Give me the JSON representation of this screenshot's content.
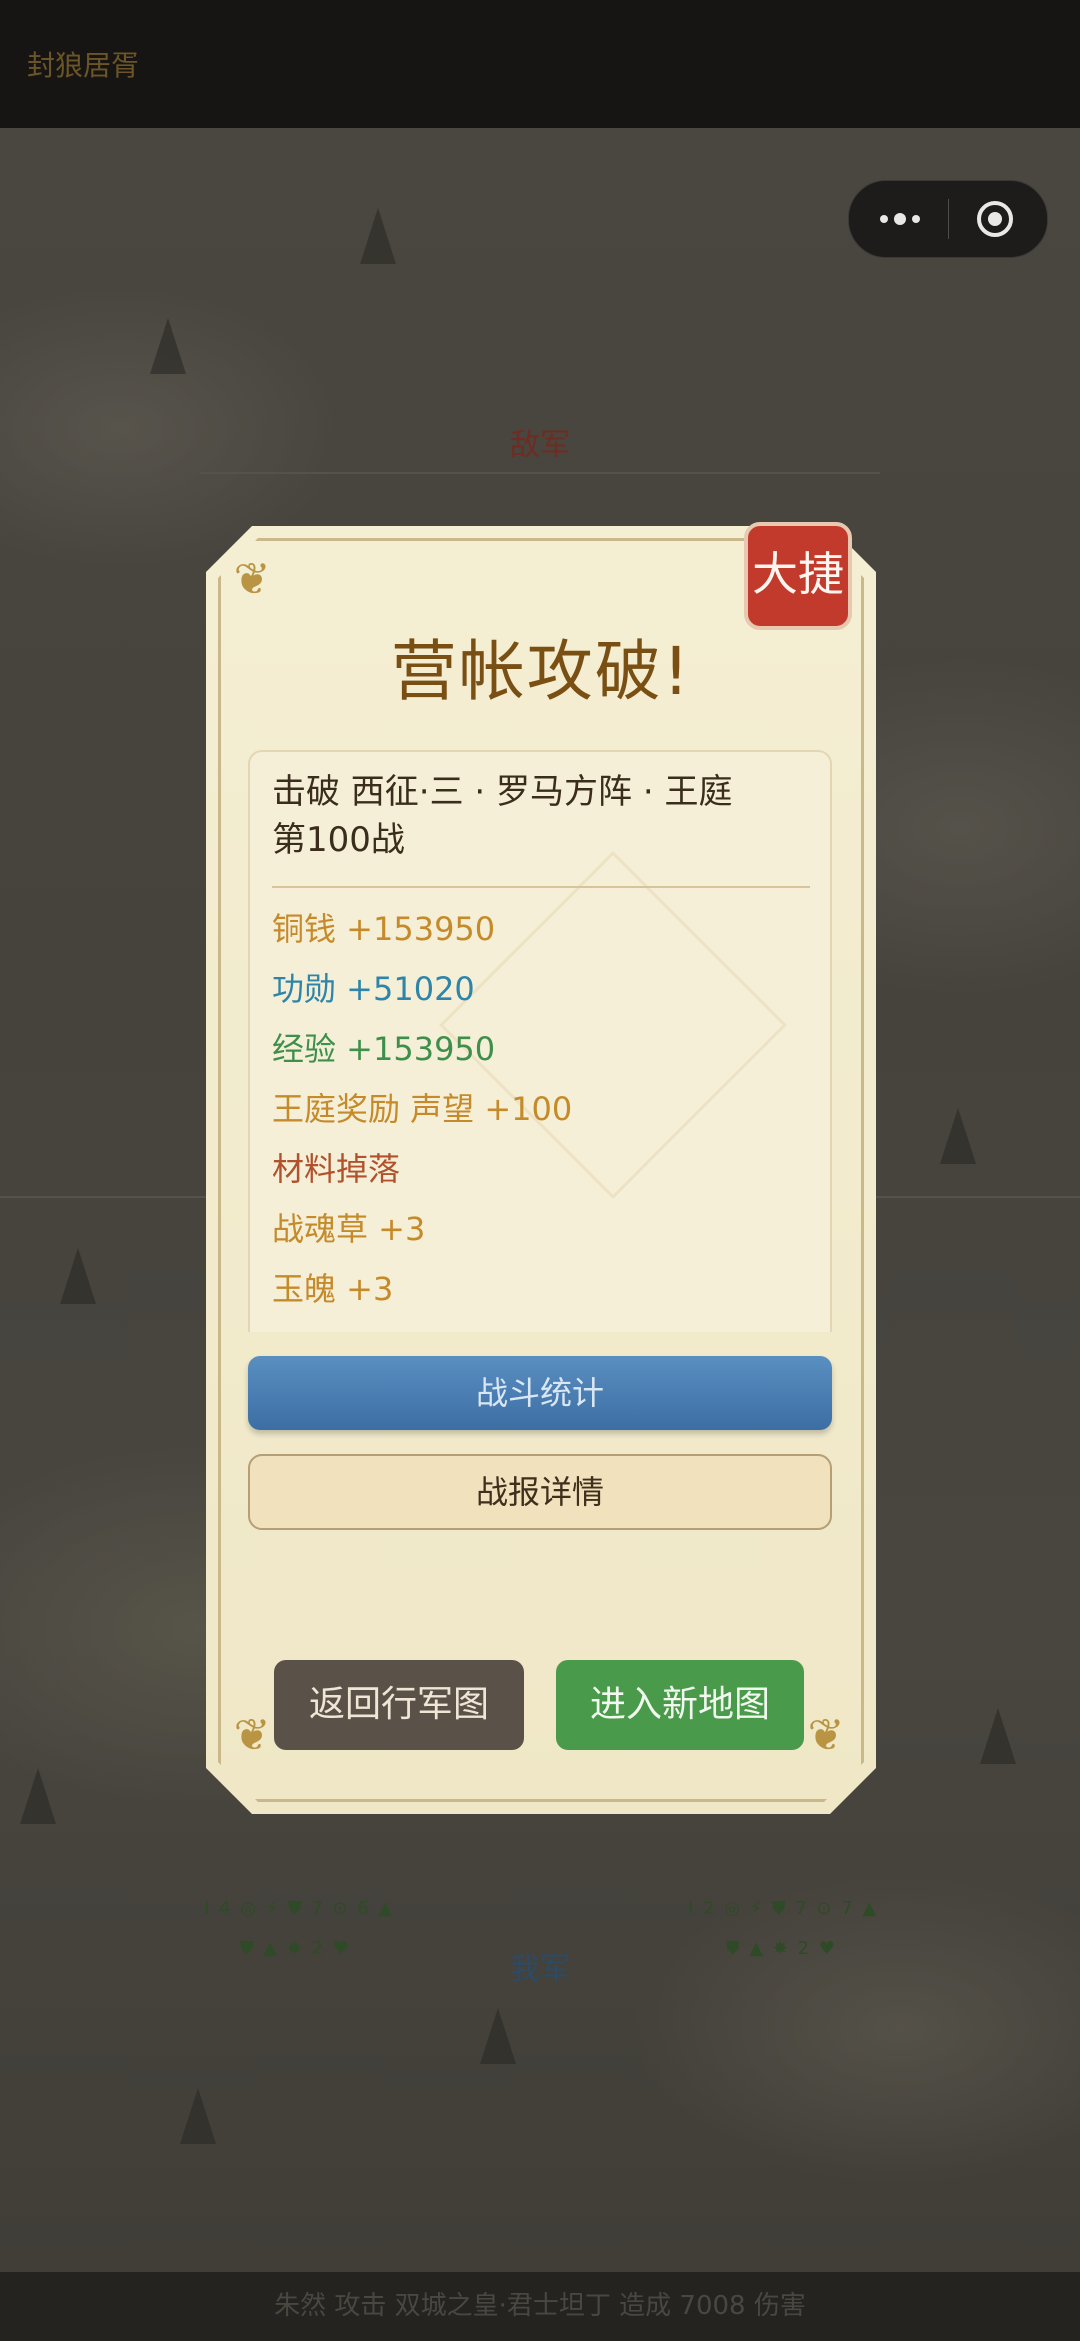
{
  "header": {
    "app_title": "封狼居胥"
  },
  "capsule": {
    "more_icon": "more-dots-icon",
    "close_icon": "target-circle-icon"
  },
  "battlefield": {
    "enemy_label": "敌军",
    "ally_label": "我军",
    "ally_stats_left": "I 4 ◎ ⚡ ⛊ 7 ⊙ 6 ▲",
    "ally_stats_left_2": "⛊ ▲ ✸ 2 ♥",
    "ally_stats_right": "I 2 ◎ ⚡ ⛊ 7 ⊙ 7 ▲",
    "ally_stats_right_2": "⛊ ▲ ✸ 2 ♥"
  },
  "bottom_log": "朱然 攻击 双城之皇·君士坦丁 造成 7008 伤害",
  "modal": {
    "badge": "大捷",
    "title": "营帐攻破!",
    "result_line1": "击破 西征·三 · 罗马方阵 · 王庭",
    "result_line2": "第100战",
    "rewards": [
      {
        "text": "铜钱 +153950",
        "color": "#c58a2a"
      },
      {
        "text": "功勋 +51020",
        "color": "#2f85a8"
      },
      {
        "text": "经验 +153950",
        "color": "#3f8f4c"
      },
      {
        "text": "王庭奖励  声望 +100",
        "color": "#c58a2a"
      },
      {
        "text": "材料掉落",
        "color": "#b0532d"
      },
      {
        "text": "战魂草 +3",
        "color": "#c58a2a"
      },
      {
        "text": "玉魄 +3",
        "color": "#c58a2a"
      }
    ],
    "btn_stats": "战斗统计",
    "btn_report": "战报详情",
    "btn_back": "返回行军图",
    "btn_new_map": "进入新地图"
  },
  "colors": {
    "accent_title": "#7a4f13",
    "badge_red": "#c23a2b",
    "button_blue": "#3c6ea3",
    "button_green": "#4a9a4b"
  }
}
